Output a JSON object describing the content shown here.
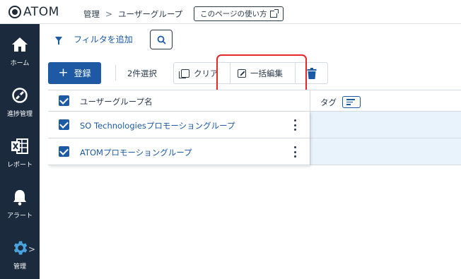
{
  "header": {
    "logo_text": "ATOM",
    "breadcrumbs": [
      "管理",
      "ユーザーグループ"
    ],
    "howto_label": "このページの使い方"
  },
  "sidebar": {
    "items": [
      {
        "label": "ホーム",
        "icon": "home-icon"
      },
      {
        "label": "進捗管理",
        "icon": "progress-icon"
      },
      {
        "label": "レポート",
        "icon": "report-icon"
      },
      {
        "label": "アラート",
        "icon": "bell-icon"
      },
      {
        "label": "管理",
        "icon": "gear-icon"
      }
    ]
  },
  "toolbar": {
    "filter_label": "フィルタを追加",
    "register_label": "登録",
    "selected_count": "2件選択",
    "clear_label": "クリア",
    "bulk_edit_label": "一括編集"
  },
  "table": {
    "columns": [
      "ユーザーグループ名",
      "タグ"
    ],
    "rows": [
      {
        "name": "SO Technologiesプロモーショングループ",
        "tag": ""
      },
      {
        "name": "ATOMプロモーショングループ",
        "tag": ""
      }
    ]
  },
  "colors": {
    "sidebar_bg": "#1b2a3d",
    "accent": "#1d5aa3",
    "highlight": "#e8262b",
    "selected_row_bg": "#e9f3fb"
  }
}
